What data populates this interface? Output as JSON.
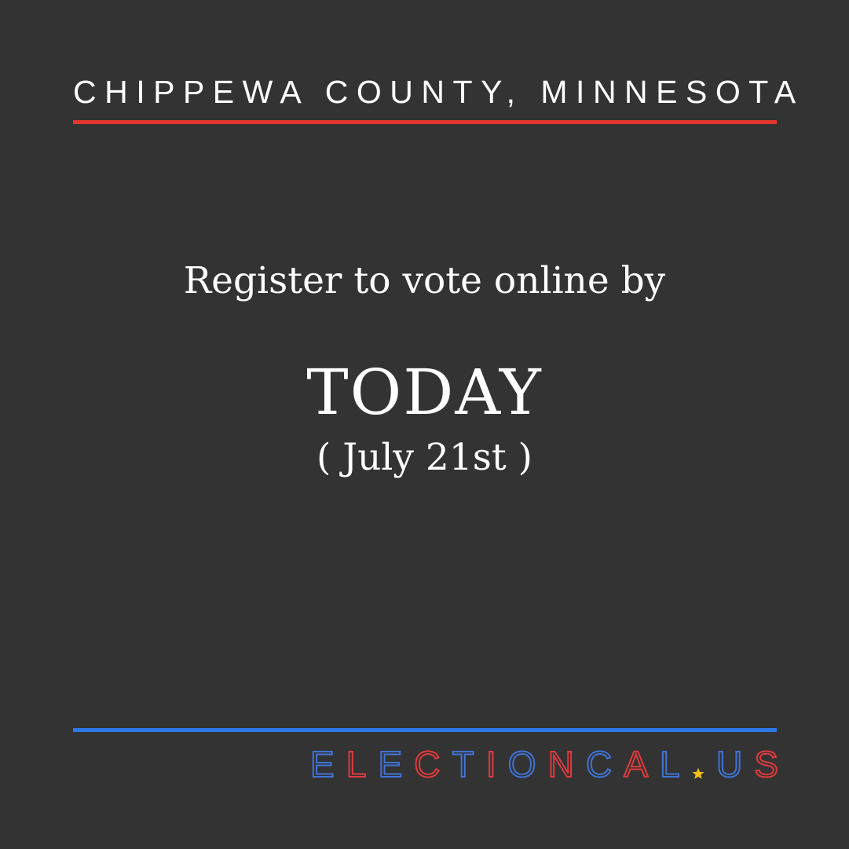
{
  "header": {
    "county": "CHIPPEWA COUNTY, MINNESOTA"
  },
  "message": {
    "line1": "Register to vote online by",
    "emphasis": "TODAY",
    "date": "( July 21st )"
  },
  "branding": {
    "logo_text": "ELECTIONCAL.US",
    "logo_letters": [
      "E",
      "L",
      "E",
      "C",
      "T",
      "I",
      "O",
      "N",
      "C",
      "A",
      "L",
      "★",
      "U",
      "S"
    ]
  },
  "colors": {
    "background": "#333333",
    "red": "#e5352f",
    "blue": "#2d78e6",
    "star": "#f2c019"
  }
}
